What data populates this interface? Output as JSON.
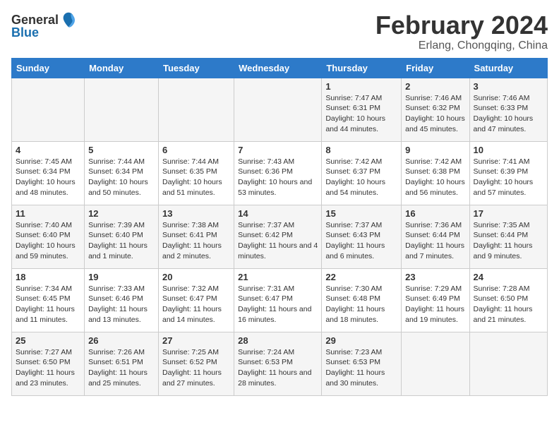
{
  "logo": {
    "text_general": "General",
    "text_blue": "Blue"
  },
  "title": "February 2024",
  "subtitle": "Erlang, Chongqing, China",
  "headers": [
    "Sunday",
    "Monday",
    "Tuesday",
    "Wednesday",
    "Thursday",
    "Friday",
    "Saturday"
  ],
  "weeks": [
    [
      {
        "day": "",
        "info": ""
      },
      {
        "day": "",
        "info": ""
      },
      {
        "day": "",
        "info": ""
      },
      {
        "day": "",
        "info": ""
      },
      {
        "day": "1",
        "info": "Sunrise: 7:47 AM\nSunset: 6:31 PM\nDaylight: 10 hours\nand 44 minutes."
      },
      {
        "day": "2",
        "info": "Sunrise: 7:46 AM\nSunset: 6:32 PM\nDaylight: 10 hours\nand 45 minutes."
      },
      {
        "day": "3",
        "info": "Sunrise: 7:46 AM\nSunset: 6:33 PM\nDaylight: 10 hours\nand 47 minutes."
      }
    ],
    [
      {
        "day": "4",
        "info": "Sunrise: 7:45 AM\nSunset: 6:34 PM\nDaylight: 10 hours\nand 48 minutes."
      },
      {
        "day": "5",
        "info": "Sunrise: 7:44 AM\nSunset: 6:34 PM\nDaylight: 10 hours\nand 50 minutes."
      },
      {
        "day": "6",
        "info": "Sunrise: 7:44 AM\nSunset: 6:35 PM\nDaylight: 10 hours\nand 51 minutes."
      },
      {
        "day": "7",
        "info": "Sunrise: 7:43 AM\nSunset: 6:36 PM\nDaylight: 10 hours\nand 53 minutes."
      },
      {
        "day": "8",
        "info": "Sunrise: 7:42 AM\nSunset: 6:37 PM\nDaylight: 10 hours\nand 54 minutes."
      },
      {
        "day": "9",
        "info": "Sunrise: 7:42 AM\nSunset: 6:38 PM\nDaylight: 10 hours\nand 56 minutes."
      },
      {
        "day": "10",
        "info": "Sunrise: 7:41 AM\nSunset: 6:39 PM\nDaylight: 10 hours\nand 57 minutes."
      }
    ],
    [
      {
        "day": "11",
        "info": "Sunrise: 7:40 AM\nSunset: 6:40 PM\nDaylight: 10 hours\nand 59 minutes."
      },
      {
        "day": "12",
        "info": "Sunrise: 7:39 AM\nSunset: 6:40 PM\nDaylight: 11 hours\nand 1 minute."
      },
      {
        "day": "13",
        "info": "Sunrise: 7:38 AM\nSunset: 6:41 PM\nDaylight: 11 hours\nand 2 minutes."
      },
      {
        "day": "14",
        "info": "Sunrise: 7:37 AM\nSunset: 6:42 PM\nDaylight: 11 hours\nand 4 minutes."
      },
      {
        "day": "15",
        "info": "Sunrise: 7:37 AM\nSunset: 6:43 PM\nDaylight: 11 hours\nand 6 minutes."
      },
      {
        "day": "16",
        "info": "Sunrise: 7:36 AM\nSunset: 6:44 PM\nDaylight: 11 hours\nand 7 minutes."
      },
      {
        "day": "17",
        "info": "Sunrise: 7:35 AM\nSunset: 6:44 PM\nDaylight: 11 hours\nand 9 minutes."
      }
    ],
    [
      {
        "day": "18",
        "info": "Sunrise: 7:34 AM\nSunset: 6:45 PM\nDaylight: 11 hours\nand 11 minutes."
      },
      {
        "day": "19",
        "info": "Sunrise: 7:33 AM\nSunset: 6:46 PM\nDaylight: 11 hours\nand 13 minutes."
      },
      {
        "day": "20",
        "info": "Sunrise: 7:32 AM\nSunset: 6:47 PM\nDaylight: 11 hours\nand 14 minutes."
      },
      {
        "day": "21",
        "info": "Sunrise: 7:31 AM\nSunset: 6:47 PM\nDaylight: 11 hours\nand 16 minutes."
      },
      {
        "day": "22",
        "info": "Sunrise: 7:30 AM\nSunset: 6:48 PM\nDaylight: 11 hours\nand 18 minutes."
      },
      {
        "day": "23",
        "info": "Sunrise: 7:29 AM\nSunset: 6:49 PM\nDaylight: 11 hours\nand 19 minutes."
      },
      {
        "day": "24",
        "info": "Sunrise: 7:28 AM\nSunset: 6:50 PM\nDaylight: 11 hours\nand 21 minutes."
      }
    ],
    [
      {
        "day": "25",
        "info": "Sunrise: 7:27 AM\nSunset: 6:50 PM\nDaylight: 11 hours\nand 23 minutes."
      },
      {
        "day": "26",
        "info": "Sunrise: 7:26 AM\nSunset: 6:51 PM\nDaylight: 11 hours\nand 25 minutes."
      },
      {
        "day": "27",
        "info": "Sunrise: 7:25 AM\nSunset: 6:52 PM\nDaylight: 11 hours\nand 27 minutes."
      },
      {
        "day": "28",
        "info": "Sunrise: 7:24 AM\nSunset: 6:53 PM\nDaylight: 11 hours\nand 28 minutes."
      },
      {
        "day": "29",
        "info": "Sunrise: 7:23 AM\nSunset: 6:53 PM\nDaylight: 11 hours\nand 30 minutes."
      },
      {
        "day": "",
        "info": ""
      },
      {
        "day": "",
        "info": ""
      }
    ]
  ]
}
